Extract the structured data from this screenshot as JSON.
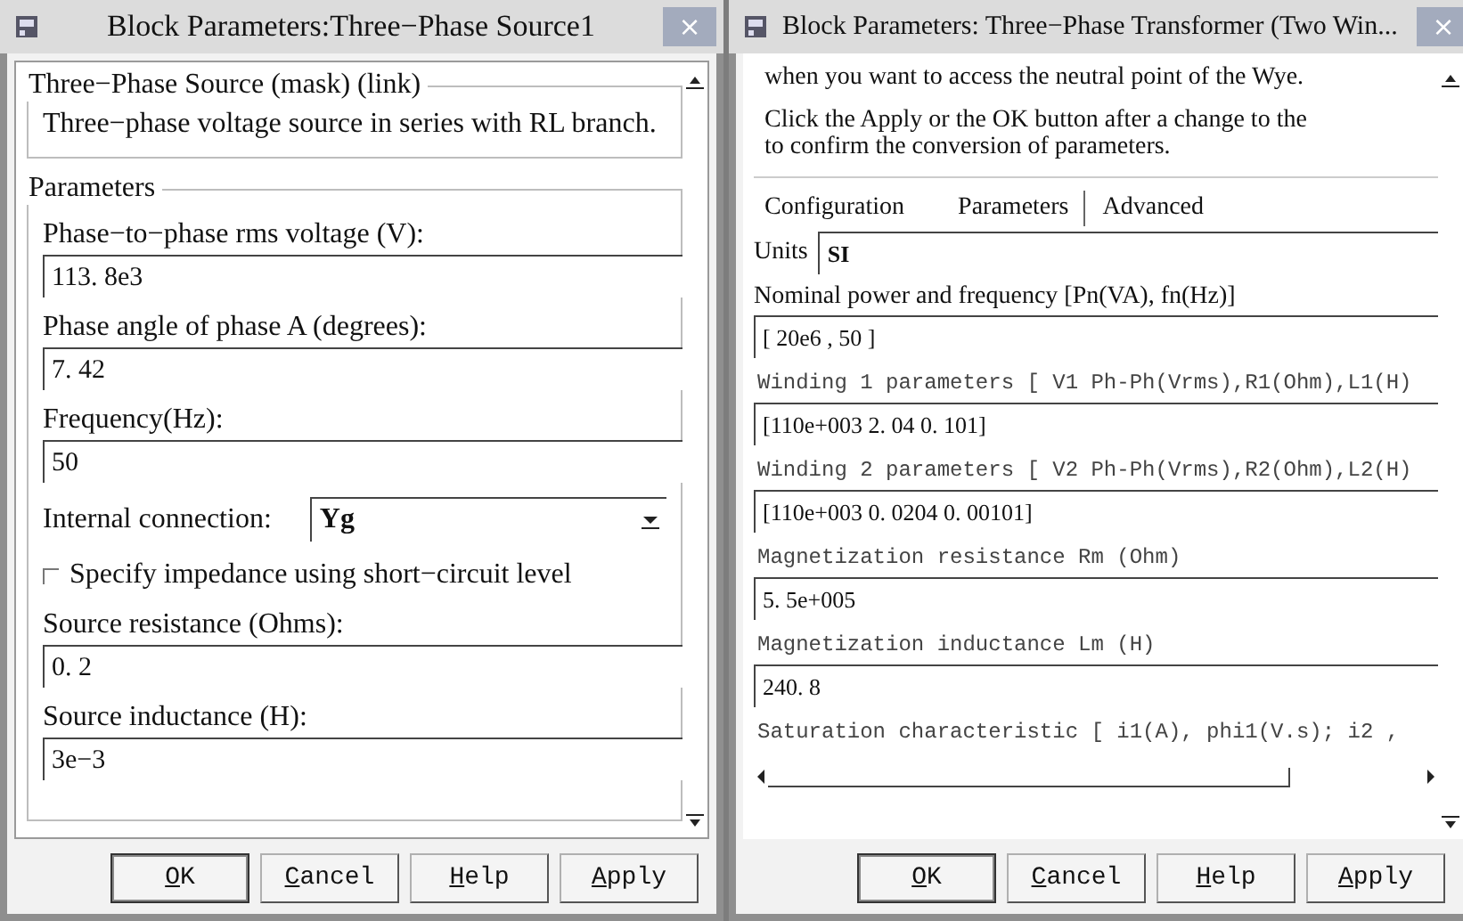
{
  "source_dialog": {
    "title": "Block Parameters:Three−Phase Source1",
    "close": "×",
    "mask_group": {
      "legend": "Three−Phase Source (mask) (link)",
      "description": "Three−phase voltage source in series with RL branch."
    },
    "parameters_group": {
      "legend": "Parameters",
      "fields": [
        {
          "kind": "text",
          "label": "Phase−to−phase rms voltage (V):",
          "value": "113. 8e3"
        },
        {
          "kind": "text",
          "label": "Phase angle of phase A (degrees):",
          "value": "7. 42"
        },
        {
          "kind": "text",
          "label": "Frequency(Hz):",
          "value": "50"
        },
        {
          "kind": "select",
          "label": "Internal connection:",
          "value": "Yg"
        },
        {
          "kind": "checkbox",
          "label": "Specify impedance using short−circuit level",
          "checked": false
        },
        {
          "kind": "text",
          "label": "Source resistance (Ohms):",
          "value": "0. 2"
        },
        {
          "kind": "text",
          "label": "Source inductance (H):",
          "value": "3e−3"
        }
      ]
    },
    "buttons": [
      {
        "label": "OK",
        "default": true
      },
      {
        "label": "Cancel",
        "default": false
      },
      {
        "label": "Help",
        "default": false
      },
      {
        "label": "Apply",
        "default": false
      }
    ]
  },
  "transformer_dialog": {
    "title": "Block Parameters: Three−Phase Transformer (Two Win...",
    "close": "×",
    "notes": [
      {
        "lines": [
          "when you want to access the neutral point of the Wye."
        ]
      },
      {
        "lines": [
          "Click the Apply or the OK button after a change to the",
          "to confirm the conversion of parameters."
        ]
      }
    ],
    "tabs": [
      {
        "label": "Configuration",
        "selected": false
      },
      {
        "label": "Parameters",
        "selected": true
      },
      {
        "label": "Advanced",
        "selected": false
      }
    ],
    "units": {
      "label": "Units",
      "value": "SI"
    },
    "fields": [
      {
        "kind": "text",
        "label": "Nominal power and frequency [Pn(VA), fn(Hz)]",
        "value": "[ 20e6 , 50 ]"
      },
      {
        "kind": "code",
        "label": "Winding 1 parameters [ V1 Ph-Ph(Vrms),R1(Ohm),L1(H)",
        "value": "[110e+003 2. 04 0. 101]"
      },
      {
        "kind": "code",
        "label": "Winding 2 parameters [ V2 Ph-Ph(Vrms),R2(Ohm),L2(H)",
        "value": "[110e+003 0. 0204 0. 00101]"
      },
      {
        "kind": "code",
        "label": "Magnetization resistance Rm (Ohm)",
        "value": "5. 5e+005"
      },
      {
        "kind": "code",
        "label": "Magnetization inductance Lm (H)",
        "value": "240. 8"
      },
      {
        "kind": "code",
        "label": "Saturation characteristic [ i1(A), phi1(V.s); i2 ,"
      }
    ],
    "buttons": [
      {
        "label": "OK",
        "default": true
      },
      {
        "label": "Cancel",
        "default": false
      },
      {
        "label": "Help",
        "default": false
      },
      {
        "label": "Apply",
        "default": false
      }
    ]
  }
}
